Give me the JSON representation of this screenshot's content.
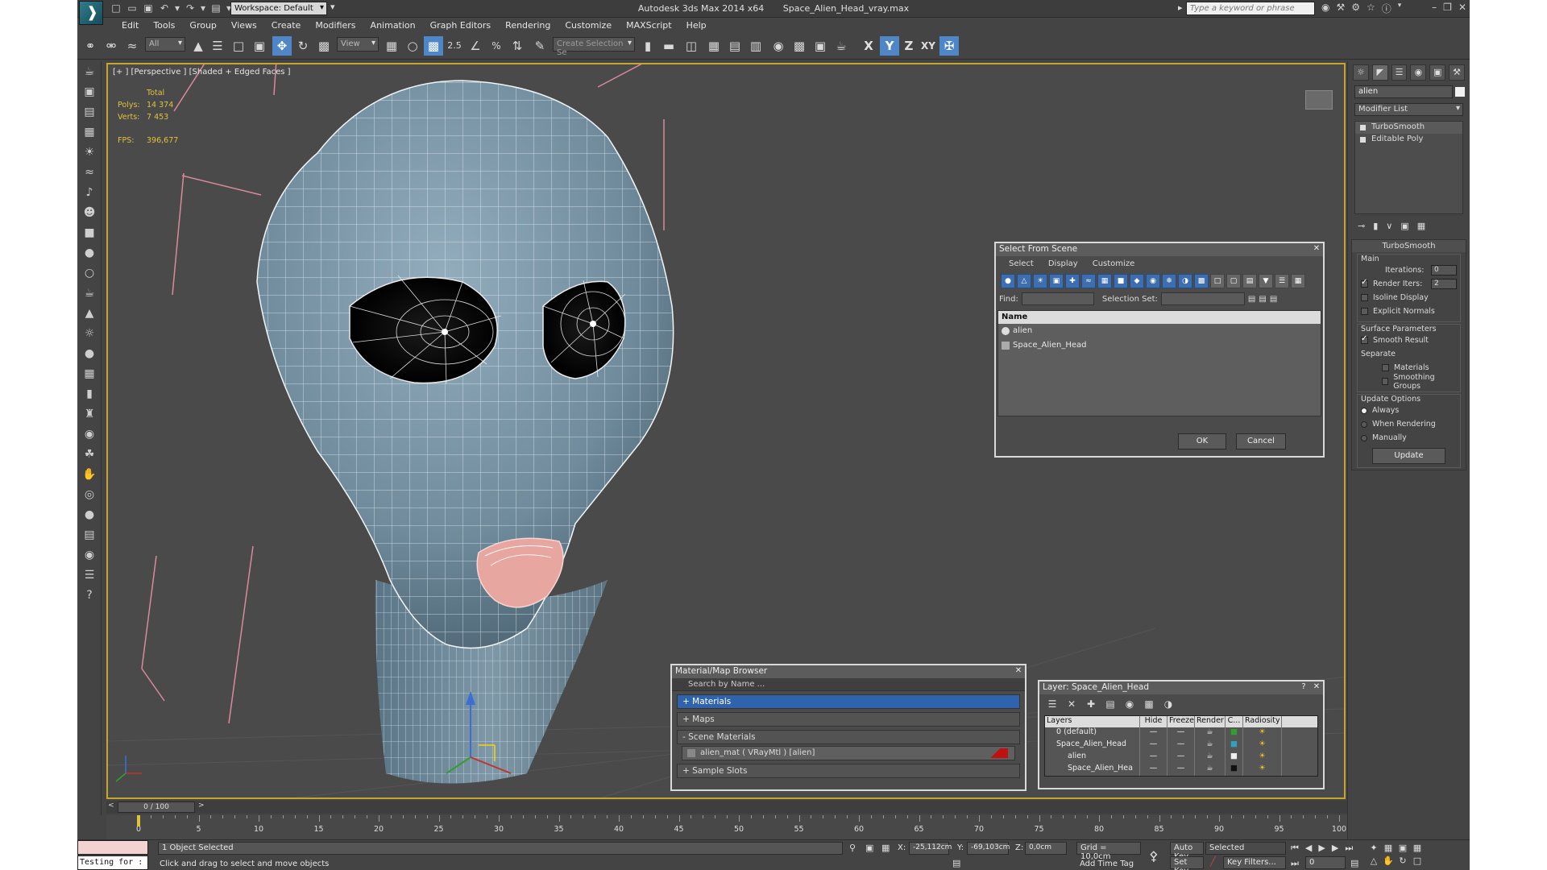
{
  "titlebar": {
    "workspace": "Workspace: Default",
    "app_name": "Autodesk 3ds Max  2014 x64",
    "file_name": "Space_Alien_Head_vray.max",
    "search_placeholder": "Type a keyword or phrase"
  },
  "menu": [
    "Edit",
    "Tools",
    "Group",
    "Views",
    "Create",
    "Modifiers",
    "Animation",
    "Graph Editors",
    "Rendering",
    "Customize",
    "MAXScript",
    "Help"
  ],
  "toolbar": {
    "selection_filter": "All",
    "ref_coord": "View",
    "snap_label": "2.5",
    "selection_set_placeholder": "Create Selection Se",
    "axes": [
      "X",
      "Y",
      "Z",
      "XY"
    ]
  },
  "viewport": {
    "label": "[+ ] [Perspective ] [Shaded + Edged Faces ]",
    "stats_header": "Total",
    "polys_label": "Polys:",
    "polys_value": "14 374",
    "verts_label": "Verts:",
    "verts_value": "7 453",
    "fps_label": "FPS:",
    "fps_value": "396,677"
  },
  "select_from_scene": {
    "title": "Select From Scene",
    "menu": [
      "Select",
      "Display",
      "Customize"
    ],
    "find_label": "Find:",
    "selection_set_label": "Selection Set:",
    "column_name": "Name",
    "items": [
      "alien",
      "Space_Alien_Head"
    ],
    "ok": "OK",
    "cancel": "Cancel"
  },
  "material_browser": {
    "title": "Material/Map Browser",
    "search_placeholder": "Search by Name ...",
    "materials": "+ Materials",
    "maps": "+ Maps",
    "scene_materials": "- Scene Materials",
    "scene_item": "alien_mat  ( VRayMtl )  [alien]",
    "sample_slots": "+ Sample Slots"
  },
  "layer_window": {
    "title": "Layer: Space_Alien_Head",
    "headers": [
      "Layers",
      "Hide",
      "Freeze",
      "Render",
      "C...",
      "Radiosity"
    ],
    "rows": [
      "0 (default)",
      "Space_Alien_Head",
      "alien",
      "Space_Alien_Hea"
    ]
  },
  "command_panel": {
    "object_name": "alien",
    "modifier_list": "Modifier List",
    "stack": [
      "TurboSmooth",
      "Editable Poly"
    ],
    "rollout_title": "TurboSmooth",
    "main_label": "Main",
    "iterations_label": "Iterations:",
    "iterations_value": "0",
    "render_iters_label": "Render Iters:",
    "render_iters_value": "2",
    "isoline": "Isoline Display",
    "explicit_normals": "Explicit Normals",
    "surface_params": "Surface Parameters",
    "smooth_result": "Smooth Result",
    "separate": "Separate",
    "materials": "Materials",
    "smoothing_groups": "Smoothing Groups",
    "update_options": "Update Options",
    "always": "Always",
    "when_rendering": "When Rendering",
    "manually": "Manually",
    "update_button": "Update"
  },
  "timeline": {
    "position": "0 / 100",
    "ticks": [
      "0",
      "5",
      "10",
      "15",
      "20",
      "25",
      "30",
      "35",
      "40",
      "45",
      "50",
      "55",
      "60",
      "65",
      "70",
      "75",
      "80",
      "85",
      "90",
      "95",
      "100"
    ]
  },
  "status": {
    "selection": "1 Object Selected",
    "prompt": "Click and drag to select and move objects",
    "maxscript": "Testing for :",
    "x_label": "X:",
    "x_value": "-25,112cm",
    "y_label": "Y:",
    "y_value": "-69,103cm",
    "z_label": "Z:",
    "z_value": "0,0cm",
    "grid": "Grid = 10,0cm",
    "add_time_tag": "Add Time Tag",
    "auto_key": "Auto Key",
    "set_key": "Set Key",
    "selected": "Selected",
    "key_filters": "Key Filters...",
    "frame": "0"
  },
  "colors": {
    "viewport_border": "#c7a62b",
    "stats_text": "#e0c23a",
    "active_blue": "#4e86c8",
    "skin": "#7f98a8",
    "mouth": "#e8a6a0"
  }
}
